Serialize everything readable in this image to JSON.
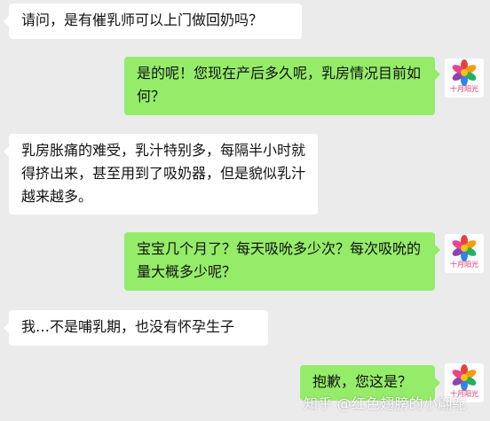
{
  "chat": {
    "messages": [
      {
        "side": "left",
        "text": "请问，是有催乳师可以上门做回奶吗？"
      },
      {
        "side": "right",
        "text": "是的呢！您现在产后多久呢，乳房情况目前如何？"
      },
      {
        "side": "left",
        "text": "乳房胀痛的难受，乳汁特别多，每隔半小时就得挤出来，甚至用到了吸奶器，但是貌似乳汁越来越多。"
      },
      {
        "side": "right",
        "text": "宝宝几个月了？每天吸吮多少次？每次吸吮的量大概多少呢？"
      },
      {
        "side": "left",
        "text": "我…不是哺乳期，也没有怀孕生子"
      },
      {
        "side": "right",
        "text": "抱歉，您这是？"
      }
    ],
    "avatar": {
      "icon": "flower-logo-icon",
      "label": "十月阳光"
    }
  },
  "watermark": "知乎 @红色翅膀的小翩鸵",
  "colors": {
    "background": "#ebebeb",
    "incoming_bubble": "#ffffff",
    "outgoing_bubble": "#95ec69",
    "logo_text": "#e0306a"
  }
}
